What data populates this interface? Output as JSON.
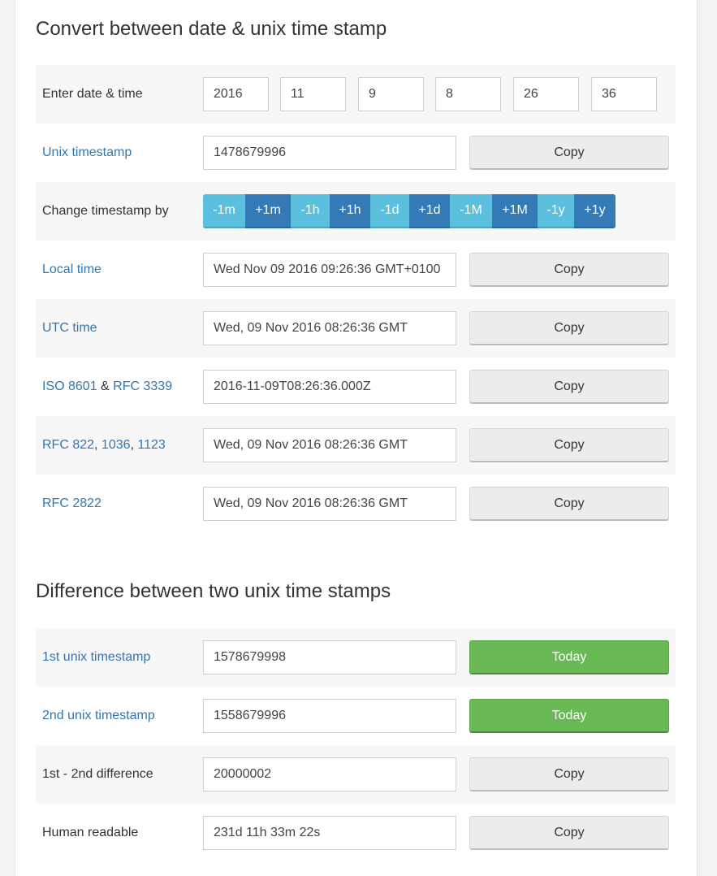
{
  "converter": {
    "heading": "Convert between date & unix time stamp",
    "date_row": {
      "label": "Enter date & time",
      "year": "2016",
      "month": "11",
      "day": "9",
      "hour": "8",
      "minute": "26",
      "second": "36"
    },
    "unix_row": {
      "label": "Unix timestamp",
      "value": "1478679996",
      "button": "Copy"
    },
    "change_row": {
      "label": "Change timestamp by",
      "buttons": [
        "-1m",
        "+1m",
        "-1h",
        "+1h",
        "-1d",
        "+1d",
        "-1M",
        "+1M",
        "-1y",
        "+1y"
      ]
    },
    "local_row": {
      "label": "Local time",
      "value": "Wed Nov 09 2016 09:26:36 GMT+0100",
      "button": "Copy"
    },
    "utc_row": {
      "label": "UTC time",
      "value": "Wed, 09 Nov 2016 08:26:36 GMT",
      "button": "Copy"
    },
    "iso_row": {
      "label_a": "ISO 8601",
      "label_sep": " & ",
      "label_b": "RFC 3339",
      "value": "2016-11-09T08:26:36.000Z",
      "button": "Copy"
    },
    "rfc822_row": {
      "label_a": "RFC 822",
      "sep1": ", ",
      "label_b": "1036",
      "sep2": ", ",
      "label_c": "1123",
      "value": "Wed, 09 Nov 2016 08:26:36 GMT",
      "button": "Copy"
    },
    "rfc2822_row": {
      "label": "RFC 2822",
      "value": "Wed, 09 Nov 2016 08:26:36 GMT",
      "button": "Copy"
    }
  },
  "difference": {
    "heading": "Difference between two unix time stamps",
    "first_row": {
      "label": "1st unix timestamp",
      "value": "1578679998",
      "button": "Today"
    },
    "second_row": {
      "label": "2nd unix timestamp",
      "value": "1558679996",
      "button": "Today"
    },
    "diff_row": {
      "label": "1st - 2nd difference",
      "value": "20000002",
      "button": "Copy"
    },
    "human_row": {
      "label": "Human readable",
      "value": "231d 11h 33m 22s",
      "button": "Copy"
    }
  },
  "colors": {
    "link": "#3277b3",
    "btn_light": "#5bc0de",
    "btn_dark": "#337ab7",
    "btn_green": "#6ab957",
    "row_shade": "#f7f7f7"
  }
}
